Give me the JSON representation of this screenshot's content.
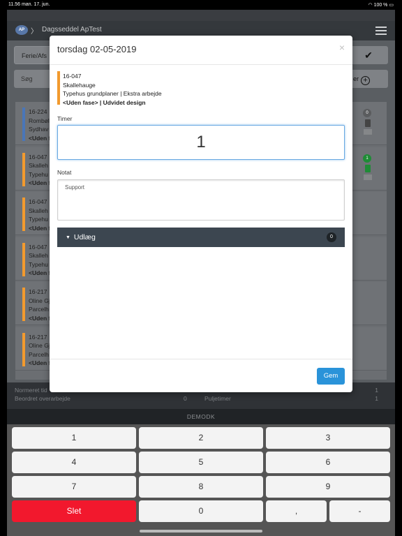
{
  "status_bar": {
    "time_date": "11.56  man. 17. jun.",
    "battery": "100 %"
  },
  "app": {
    "logo_text": "AP",
    "breadcrumb_separator": "〉",
    "title": "Dagsseddel ApTest",
    "filter_select": "Ferie/Afs",
    "search_placeholder": "Søg",
    "add_label": "er"
  },
  "entries": [
    {
      "code": "16-224",
      "name": "Rombøl",
      "desc": "Sydhav",
      "phase": "<Uden f",
      "color": "#4a76b8",
      "badge": "0",
      "badge_color": "#5a5c5e",
      "doc_color": "#444444"
    },
    {
      "code": "16-047",
      "name": "Skalleh",
      "desc": "Typehu",
      "phase": "<Uden f",
      "color": "#f29a2e",
      "badge": "1",
      "badge_color": "#1f8c36",
      "doc_color": "#1f8c36"
    },
    {
      "code": "16-047",
      "name": "Skalleh",
      "desc": "Typehu",
      "phase": "<Uden f",
      "color": "#f29a2e"
    },
    {
      "code": "16-047",
      "name": "Skalleh",
      "desc": "Typehu",
      "phase": "<Uden f",
      "color": "#f29a2e"
    },
    {
      "code": "16-217",
      "name": "Oline Gj",
      "desc": "Parcelh",
      "phase": "<Uden f",
      "color": "#f29a2e"
    },
    {
      "code": "16-217",
      "name": "Oline Gj",
      "desc": "Parcelh",
      "phase": "<Uden f",
      "color": "#f29a2e"
    }
  ],
  "totals": {
    "normeret_label": "Normeret tid",
    "beordret_label": "Beordret overarbejde",
    "beordret_value": "0",
    "puljetimer_label": "Puljetimer",
    "normeret_value": "1",
    "puljetimer_value": "1"
  },
  "demo_label": "DEMODK",
  "keypad": [
    "1",
    "2",
    "3",
    "4",
    "5",
    "6",
    "7",
    "8",
    "9",
    "Slet",
    "0",
    ",",
    "-"
  ],
  "modal": {
    "title": "torsdag 02-05-2019",
    "close_glyph": "×",
    "info": {
      "code": "16-047",
      "name": "Skallehauge",
      "desc": "Typehus grundplaner | Ekstra arbejde",
      "phase_bold": "<Uden fase>",
      "phase_rest": " | Udvidet design"
    },
    "timer_label": "Timer",
    "timer_value": "1",
    "notat_label": "Notat",
    "notat_value": "Support",
    "udlaeg_label": "Udlæg",
    "udlaeg_count": "0",
    "save_label": "Gem"
  }
}
